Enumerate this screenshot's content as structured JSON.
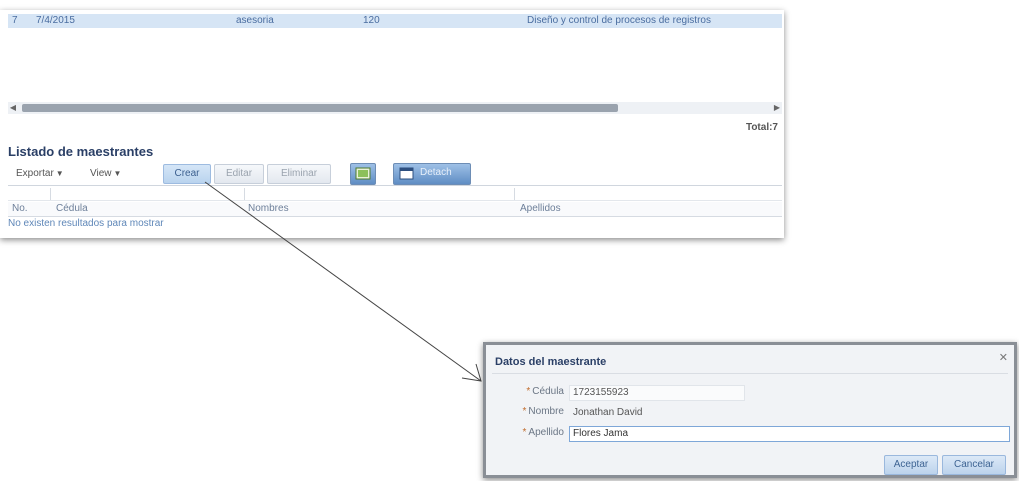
{
  "top_grid": {
    "selected_row": {
      "num": "7",
      "date": "7/4/2015",
      "type": "asesoria",
      "qty": "120",
      "description": "Diseño y control de procesos de registros"
    },
    "total_label": "Total:7"
  },
  "section": {
    "title": "Listado de maestrantes"
  },
  "toolbar": {
    "export_label": "Exportar",
    "view_label": "View",
    "create_label": "Crear",
    "edit_label": "Editar",
    "delete_label": "Eliminar",
    "detach_label": "Detach"
  },
  "grid": {
    "columns": [
      "No.",
      "Cédula",
      "Nombres",
      "Apellidos"
    ],
    "empty_message": "No existen resultados para mostrar"
  },
  "dialog": {
    "title": "Datos del maestrante",
    "fields": [
      {
        "label": "Cédula",
        "value": "1723155923"
      },
      {
        "label": "Nombre",
        "value": "Jonathan David"
      },
      {
        "label": "Apellido",
        "value": "Flores Jama"
      }
    ],
    "required_mark": "*",
    "accept_label": "Aceptar",
    "cancel_label": "Cancelar"
  },
  "icons": {
    "close": "close-icon",
    "dropdown": "chevron-down-icon",
    "refresh": "refresh-icon",
    "detach": "detach-icon"
  },
  "colors": {
    "accent": "#5f8dc4",
    "title": "#2a3f66",
    "selected_row": "#d6e5f5"
  }
}
